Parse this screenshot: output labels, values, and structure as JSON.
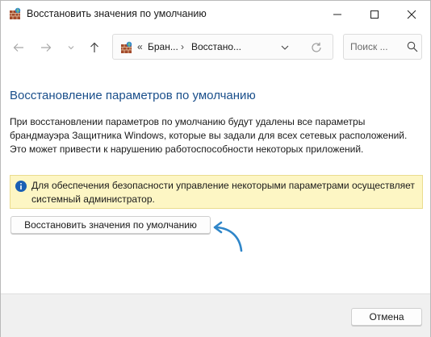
{
  "window": {
    "title": "Восстановить значения по умолчанию"
  },
  "navigation": {
    "breadcrumb_overflow": "«",
    "breadcrumbs": [
      "Бран...",
      "Восстано..."
    ],
    "search_placeholder": "Поиск ..."
  },
  "content": {
    "heading": "Восстановление параметров по умолчанию",
    "description": "При восстановлении параметров по умолчанию будут удалены все параметры брандмауэра Защитника Windows, которые вы задали для всех сетевых расположений. Это может привести к нарушению работоспособности некоторых приложений.",
    "info_message": "Для обеспечения безопасности управление некоторыми параметрами осуществляет системный администратор.",
    "restore_button_label": "Восстановить значения по умолчанию"
  },
  "footer": {
    "cancel_label": "Отмена"
  },
  "icons": {
    "app": "firewall-icon",
    "info": "info-icon",
    "annotation": "curved-arrow-icon"
  },
  "colors": {
    "heading": "#1a4f8b",
    "info_background": "#fdf6c4",
    "annotation_arrow": "#2f86c9"
  }
}
